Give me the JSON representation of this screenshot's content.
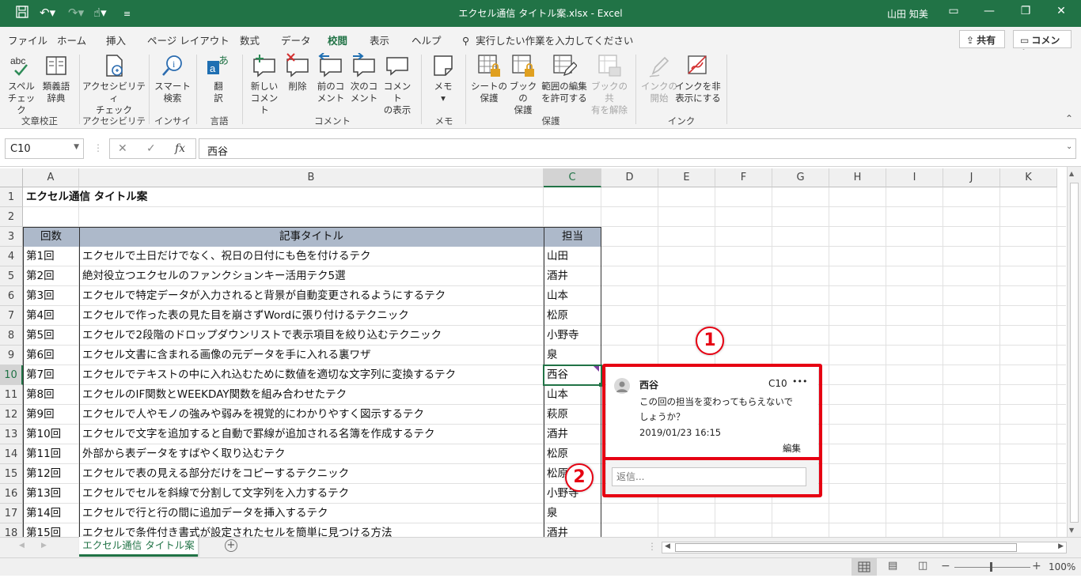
{
  "window": {
    "title": "エクセル通信 タイトル案.xlsx  -  Excel",
    "user": "山田 知美"
  },
  "menu": {
    "tabs": [
      "ファイル",
      "ホーム",
      "挿入",
      "ページ レイアウト",
      "数式",
      "データ",
      "校閲",
      "表示",
      "ヘルプ"
    ],
    "active_tab": "校閲",
    "tell_me": "実行したい作業を入力してください",
    "share": "共有",
    "comments": "コメント"
  },
  "ribbon": {
    "buttons": {
      "spell": [
        "スペル",
        "チェック"
      ],
      "thesaurus": [
        "類義語",
        "辞典"
      ],
      "accessibility": [
        "アクセシビリティ",
        "チェック"
      ],
      "smart_lookup": [
        "スマート",
        "検索"
      ],
      "translate": [
        "翻",
        "訳"
      ],
      "new_comment": [
        "新しい",
        "コメント"
      ],
      "delete": [
        "削除"
      ],
      "prev_comment": [
        "前のコ",
        "メント"
      ],
      "next_comment": [
        "次のコ",
        "メント"
      ],
      "show_comments": [
        "コメント",
        "の表示"
      ],
      "notes": [
        "メモ"
      ],
      "protect_sheet": [
        "シートの",
        "保護"
      ],
      "protect_book": [
        "ブックの",
        "保護"
      ],
      "allow_edit": [
        "範囲の編集",
        "を許可する"
      ],
      "unshare": [
        "ブックの共",
        "有を解除"
      ],
      "start_ink": [
        "インクの",
        "開始"
      ],
      "hide_ink": [
        "インクを非",
        "表示にする"
      ]
    },
    "groups": [
      "文章校正",
      "アクセシビリティ",
      "インサイト",
      "言語",
      "コメント",
      "メモ",
      "保護",
      "インク"
    ]
  },
  "formula_bar": {
    "name_box": "C10",
    "value": "西谷"
  },
  "columns": [
    "A",
    "B",
    "C",
    "D",
    "E",
    "F",
    "G",
    "H",
    "I",
    "J",
    "K"
  ],
  "rows": [
    {
      "num": "1",
      "a": "エクセル通信 タイトル案",
      "b": "",
      "c": ""
    },
    {
      "num": "2",
      "a": "",
      "b": "",
      "c": ""
    },
    {
      "num": "3",
      "a": "回数",
      "b": "記事タイトル",
      "c": "担当"
    },
    {
      "num": "4",
      "a": "第1回",
      "b": "エクセルで土日だけでなく、祝日の日付にも色を付けるテク",
      "c": "山田"
    },
    {
      "num": "5",
      "a": "第2回",
      "b": "絶対役立つエクセルのファンクションキー活用テク5選",
      "c": "酒井"
    },
    {
      "num": "6",
      "a": "第3回",
      "b": "エクセルで特定データが入力されると背景が自動変更されるようにするテク",
      "c": "山本"
    },
    {
      "num": "7",
      "a": "第4回",
      "b": "エクセルで作った表の見た目を崩さずWordに張り付けるテクニック",
      "c": "松原"
    },
    {
      "num": "8",
      "a": "第5回",
      "b": "エクセルで2段階のドロップダウンリストで表示項目を絞り込むテクニック",
      "c": "小野寺"
    },
    {
      "num": "9",
      "a": "第6回",
      "b": "エクセル文書に含まれる画像の元データを手に入れる裏ワザ",
      "c": "泉"
    },
    {
      "num": "10",
      "a": "第7回",
      "b": "エクセルでテキストの中に入れ込むために数値を適切な文字列に変換するテク",
      "c": "西谷"
    },
    {
      "num": "11",
      "a": "第8回",
      "b": "エクセルのIF関数とWEEKDAY関数を組み合わせたテク",
      "c": "山本"
    },
    {
      "num": "12",
      "a": "第9回",
      "b": "エクセルで人やモノの強みや弱みを視覚的にわかりやすく図示するテク",
      "c": "萩原"
    },
    {
      "num": "13",
      "a": "第10回",
      "b": "エクセルで文字を追加すると自動で罫線が追加される名簿を作成するテク",
      "c": "酒井"
    },
    {
      "num": "14",
      "a": "第11回",
      "b": "外部から表データをすばやく取り込むテク",
      "c": "松原"
    },
    {
      "num": "15",
      "a": "第12回",
      "b": "エクセルで表の見える部分だけをコピーするテクニック",
      "c": "松原"
    },
    {
      "num": "16",
      "a": "第13回",
      "b": "エクセルでセルを斜線で分割して文字列を入力するテク",
      "c": "小野寺"
    },
    {
      "num": "17",
      "a": "第14回",
      "b": "エクセルで行と行の間に追加データを挿入するテク",
      "c": "泉"
    },
    {
      "num": "18",
      "a": "第15回",
      "b": "エクセルで条件付き書式が設定されたセルを簡単に見つける方法",
      "c": "酒井"
    }
  ],
  "comment": {
    "author": "西谷",
    "cell": "C10",
    "more": "•••",
    "text": "この回の担当を変わってもらえないでしょうか？",
    "timestamp": "2019/01/23 16:15",
    "edit": "編集",
    "reply_placeholder": "返信..."
  },
  "callouts": [
    "1",
    "2"
  ],
  "sheet_tab": "エクセル通信 タイトル案",
  "zoom": "100%",
  "colors": {
    "accent": "#217346",
    "table_header": "#adb9ca",
    "highlight": "#e60012"
  }
}
